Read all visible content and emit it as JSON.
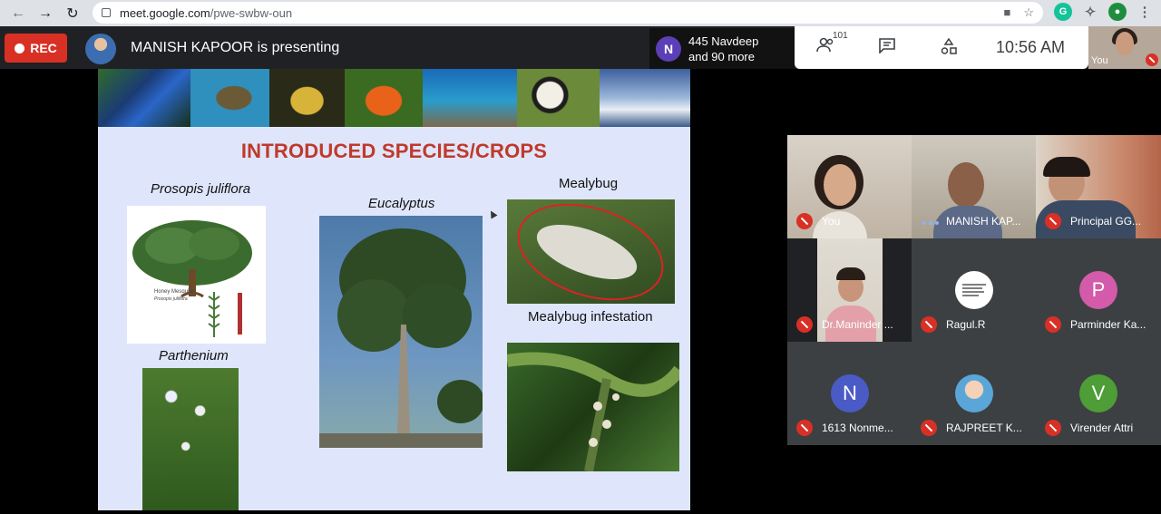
{
  "browser": {
    "url_domain": "meet.google.com",
    "url_path": "/pwe-swbw-oun"
  },
  "meet": {
    "rec_label": "REC",
    "presenter_text": "MANISH KAPOOR is presenting",
    "chip_initial": "N",
    "chip_line1": "445 Navdeep",
    "chip_line2": "and 90 more",
    "participant_count": "101",
    "time": "10:56  AM",
    "self_label": "You"
  },
  "slide": {
    "title": "INTRODUCED SPECIES/CROPS",
    "caption_prosopis": "Prosopis juliflora",
    "caption_eucalyptus": "Eucalyptus",
    "caption_mealybug": "Mealybug",
    "caption_infestation": "Mealybug infestation",
    "caption_parthenium": "Parthenium",
    "honey_label": "Honey Mesquite",
    "honey_sub": "Prosopis juliflora"
  },
  "tiles": [
    {
      "name": "You",
      "type": "video"
    },
    {
      "name": "MANISH KAP...",
      "type": "video"
    },
    {
      "name": "Principal GG...",
      "type": "video"
    },
    {
      "name": "Dr.Maninder ...",
      "type": "video"
    },
    {
      "name": "Ragul.R",
      "type": "avatar"
    },
    {
      "name": "Parminder Ka...",
      "type": "avatar",
      "initial": "P"
    },
    {
      "name": "1613 Nonme...",
      "type": "avatar",
      "initial": "N"
    },
    {
      "name": "RAJPREET K...",
      "type": "avatar"
    },
    {
      "name": "Virender Attri",
      "type": "avatar",
      "initial": "V"
    }
  ],
  "colors": {
    "rec_red": "#d93025",
    "chip_purple": "#5b3fb6",
    "p_pink": "#d35ba9",
    "n_blue": "#4a5bc5",
    "v_green": "#4e9d37",
    "title_red": "#c0392b"
  }
}
